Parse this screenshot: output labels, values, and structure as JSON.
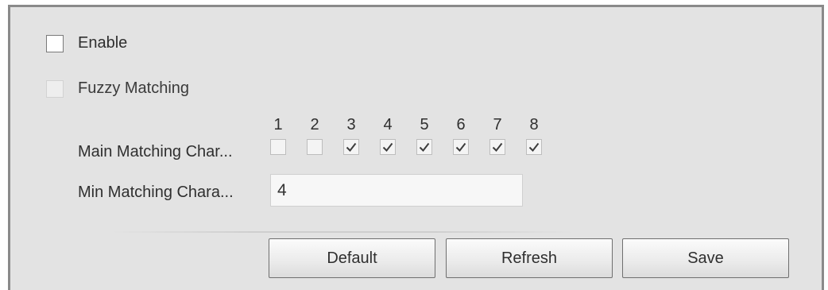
{
  "enable": {
    "label": "Enable",
    "checked": false
  },
  "fuzzy_matching": {
    "label": "Fuzzy Matching",
    "checked": false,
    "disabled": true
  },
  "main_matching": {
    "label": "Main Matching Char...",
    "positions": [
      {
        "number": "1",
        "checked": false
      },
      {
        "number": "2",
        "checked": false
      },
      {
        "number": "3",
        "checked": true
      },
      {
        "number": "4",
        "checked": true
      },
      {
        "number": "5",
        "checked": true
      },
      {
        "number": "6",
        "checked": true
      },
      {
        "number": "7",
        "checked": true
      },
      {
        "number": "8",
        "checked": true
      }
    ]
  },
  "min_matching": {
    "label": "Min Matching Chara...",
    "value": "4"
  },
  "buttons": {
    "default": "Default",
    "refresh": "Refresh",
    "save": "Save"
  }
}
